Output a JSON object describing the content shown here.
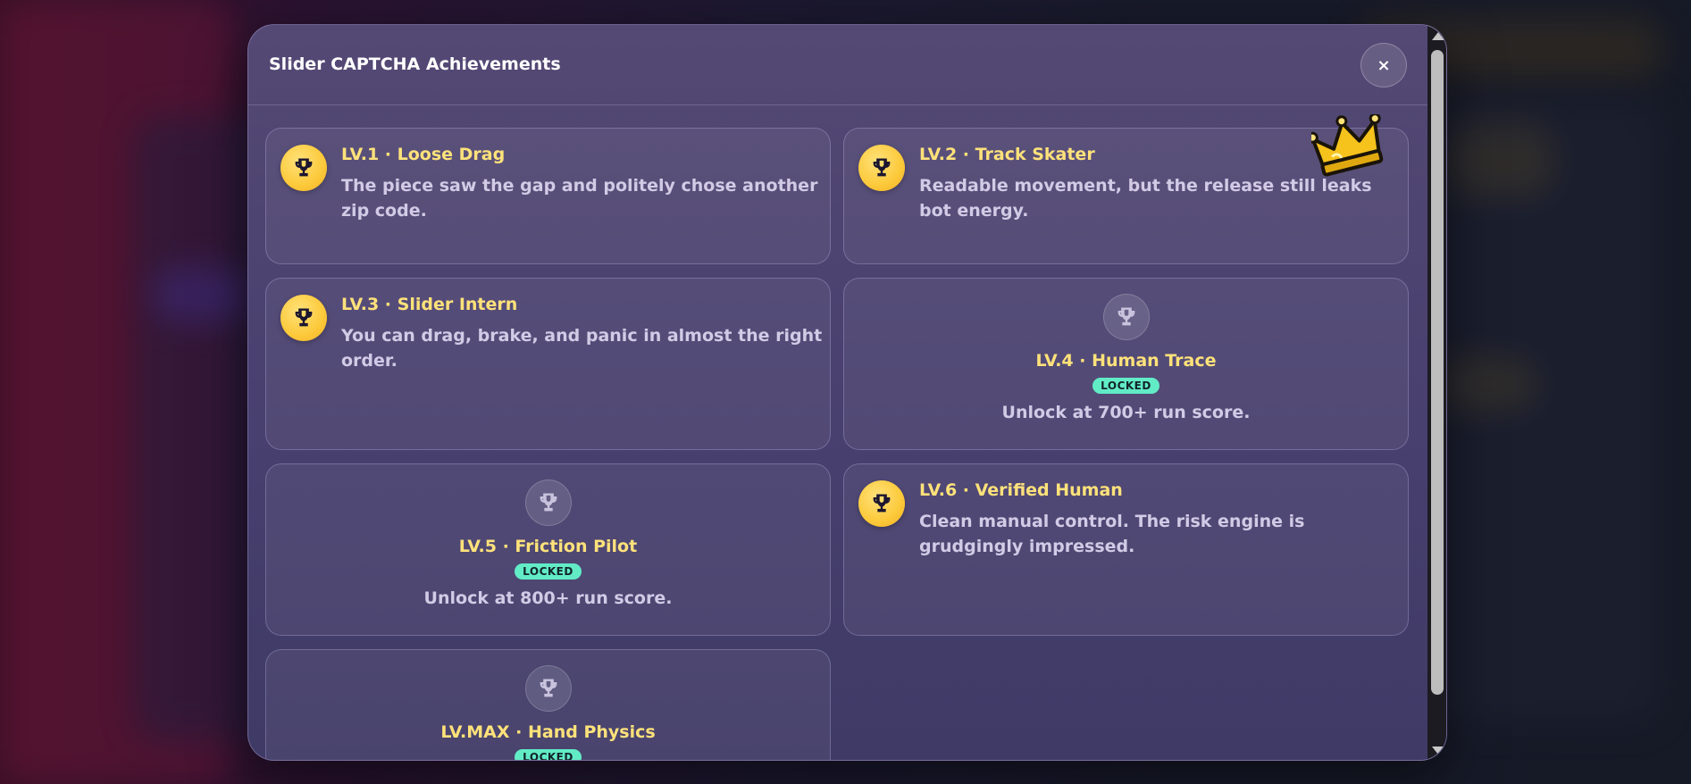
{
  "modal": {
    "title": "Slider CAPTCHA Achievements",
    "close_label": "×"
  },
  "achievements": [
    {
      "title": "LV.1 · Loose Drag",
      "description": "The piece saw the gap and politely chose another zip code.",
      "unlocked": true,
      "icon": "trophy-icon"
    },
    {
      "title": "LV.2 · Track Skater",
      "description": "Readable movement, but the release still leaks bot energy.",
      "unlocked": true,
      "icon": "trophy-icon",
      "decoration": "crown-icon"
    },
    {
      "title": "LV.3 · Slider Intern",
      "description": "You can drag, brake, and panic in almost the right order.",
      "unlocked": true,
      "icon": "trophy-icon"
    },
    {
      "title": "LV.4 · Human Trace",
      "badge": "LOCKED",
      "description": "Unlock at 700+ run score.",
      "unlocked": false,
      "icon": "trophy-icon"
    },
    {
      "title": "LV.5 · Friction Pilot",
      "badge": "LOCKED",
      "description": "Unlock at 800+ run score.",
      "unlocked": false,
      "icon": "trophy-icon"
    },
    {
      "title": "LV.6 · Verified Human",
      "description": "Clean manual control. The risk engine is grudgingly impressed.",
      "unlocked": true,
      "icon": "trophy-icon"
    },
    {
      "title": "LV.MAX · Hand Physics",
      "badge": "LOCKED",
      "unlocked": false,
      "icon": "trophy-icon"
    }
  ],
  "colors": {
    "title_gold": "#ffe27a",
    "badge_mint": "#62ecc6",
    "trophy_gold": "#fcc93a",
    "text_muted": "#d2cbe6"
  }
}
